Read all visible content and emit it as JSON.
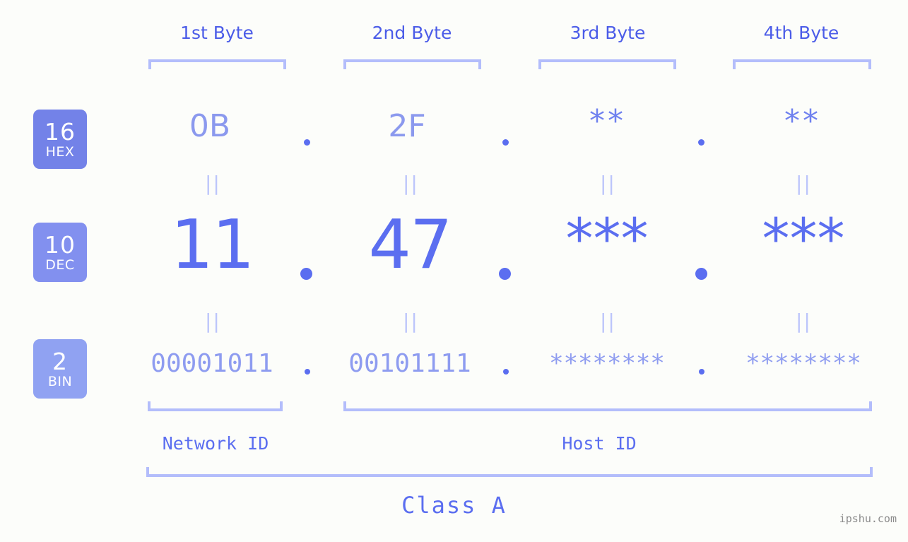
{
  "headers": [
    {
      "label": "1st Byte"
    },
    {
      "label": "2nd Byte"
    },
    {
      "label": "3rd Byte"
    },
    {
      "label": "4th Byte"
    }
  ],
  "bases": [
    {
      "num": "16",
      "name": "HEX",
      "color": "#7382e8"
    },
    {
      "num": "10",
      "name": "DEC",
      "color": "#8290ef"
    },
    {
      "num": "2",
      "name": "BIN",
      "color": "#90a2f2"
    }
  ],
  "rows": {
    "hex": {
      "values": [
        "0B",
        "2F",
        "**",
        "**"
      ]
    },
    "dec": {
      "values": [
        "11",
        "47",
        "***",
        "***"
      ]
    },
    "bin": {
      "values": [
        "00001011",
        "00101111",
        "********",
        "********"
      ]
    }
  },
  "separators": {
    "dot": ".",
    "equals": "||"
  },
  "footer": {
    "network_id": "Network ID",
    "host_id": "Host ID",
    "class": "Class A"
  },
  "watermark": "ipshu.com",
  "colors": {
    "background": "#fcfdfa",
    "bracket": "#b3bdfb",
    "header_text": "#4b5ce8",
    "dec_text": "#5b6ef0",
    "hex_text": "#8b99ee",
    "bin_text": "#8e9cf0",
    "equals": "#bcc5fb",
    "watermark": "#8b8b8b"
  }
}
